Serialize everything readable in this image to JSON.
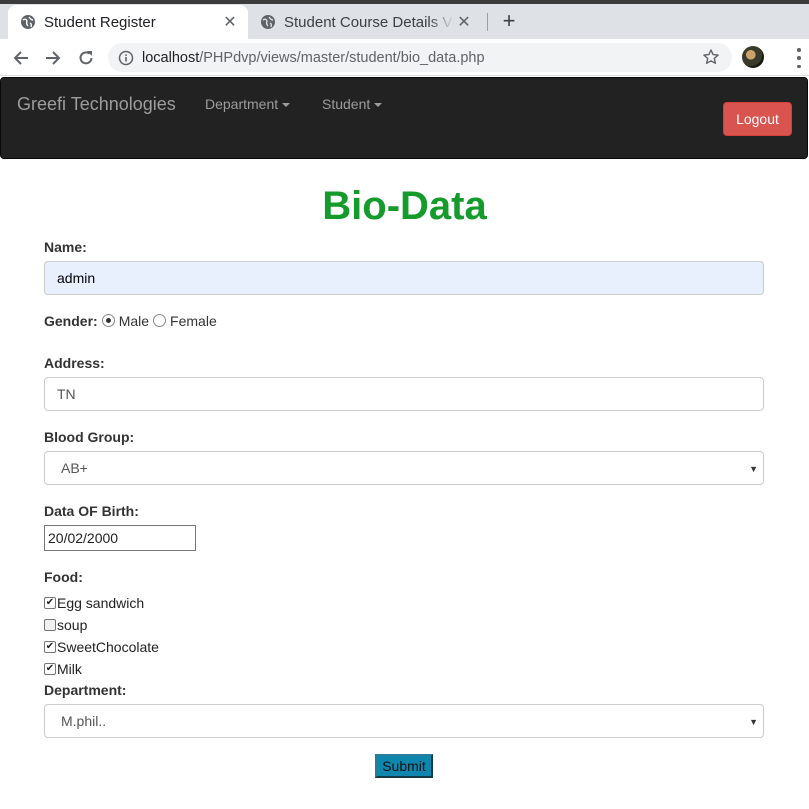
{
  "browser": {
    "tabs": [
      {
        "title": "Student Register",
        "close_glyph": "✕"
      },
      {
        "title": "Student Course Details View",
        "close_glyph": "✕"
      }
    ],
    "new_tab_glyph": "+",
    "url_host": "localhost",
    "url_path": "/PHPdvp/views/master/student/bio_data.php",
    "icons": [
      "back-arrow-icon",
      "forward-arrow-icon",
      "reload-icon",
      "info-icon",
      "bookmark-star-icon",
      "profile-avatar",
      "kebab-menu-icon",
      "globe-icon"
    ]
  },
  "navbar": {
    "brand": "Greefi Technologies",
    "menus": [
      {
        "label": "Department"
      },
      {
        "label": "Student"
      }
    ],
    "logout_label": "Logout",
    "logout_color": "#d9534f"
  },
  "form": {
    "title": "Bio-Data",
    "title_color": "#159a2c",
    "name": {
      "label": "Name:",
      "value": "admin"
    },
    "gender": {
      "label": "Gender:",
      "options": [
        {
          "label": "Male",
          "selected": true
        },
        {
          "label": "Female",
          "selected": false
        }
      ]
    },
    "address": {
      "label": "Address:",
      "value": "TN"
    },
    "blood_group": {
      "label": "Blood Group:",
      "value": "AB+"
    },
    "dob": {
      "label": "Data OF Birth:",
      "value": "20/02/2000"
    },
    "food": {
      "label": "Food:",
      "items": [
        {
          "label": "Egg sandwich",
          "checked": true
        },
        {
          "label": "soup",
          "checked": false
        },
        {
          "label": "SweetChocolate",
          "checked": true
        },
        {
          "label": "Milk",
          "checked": true
        }
      ]
    },
    "department": {
      "label": "Department:",
      "value": "M.phil.."
    },
    "submit_label": "Submit",
    "submit_color": "#0f86ad"
  }
}
